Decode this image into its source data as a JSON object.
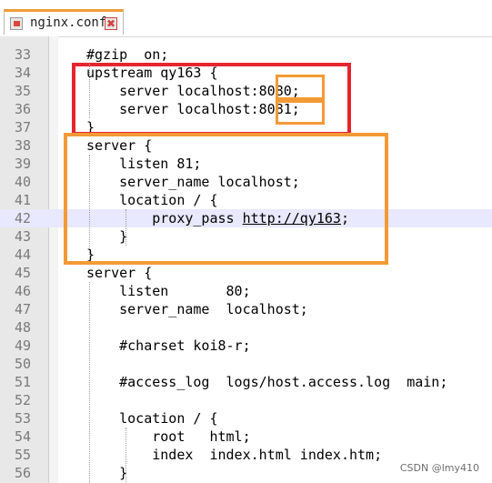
{
  "tab": {
    "title": "nginx.conf",
    "close_glyph": "✖"
  },
  "lines": [
    {
      "n": "33",
      "code": "#gzip  on;"
    },
    {
      "n": "34",
      "code": "upstream qy163 {"
    },
    {
      "n": "35",
      "code": "    server localhost:8080;"
    },
    {
      "n": "36",
      "code": "    server localhost:8081;"
    },
    {
      "n": "37",
      "code": "}"
    },
    {
      "n": "38",
      "code": "server {"
    },
    {
      "n": "39",
      "code": "    listen 81;"
    },
    {
      "n": "40",
      "code": "    server_name localhost;"
    },
    {
      "n": "41",
      "code": "    location / {"
    },
    {
      "n": "42",
      "code_pre": "        proxy_pass ",
      "link": "http://qy163",
      "code_post": ";",
      "highlighted": true
    },
    {
      "n": "43",
      "code": "    }"
    },
    {
      "n": "44",
      "code": "}"
    },
    {
      "n": "45",
      "code": "server {"
    },
    {
      "n": "46",
      "code": "    listen       80;"
    },
    {
      "n": "47",
      "code": "    server_name  localhost;"
    },
    {
      "n": "48",
      "code": ""
    },
    {
      "n": "49",
      "code": "    #charset koi8-r;"
    },
    {
      "n": "50",
      "code": ""
    },
    {
      "n": "51",
      "code": "    #access_log  logs/host.access.log  main;"
    },
    {
      "n": "52",
      "code": ""
    },
    {
      "n": "53",
      "code": "    location / {"
    },
    {
      "n": "54",
      "code": "        root   html;"
    },
    {
      "n": "55",
      "code": "        index  index.html index.htm;"
    },
    {
      "n": "56",
      "code": "    }"
    }
  ],
  "watermark": "CSDN @lmy410",
  "colors": {
    "red_box": "#e5262f",
    "orange_box": "#f39a36",
    "highlight_line": "#e8e8ff"
  }
}
